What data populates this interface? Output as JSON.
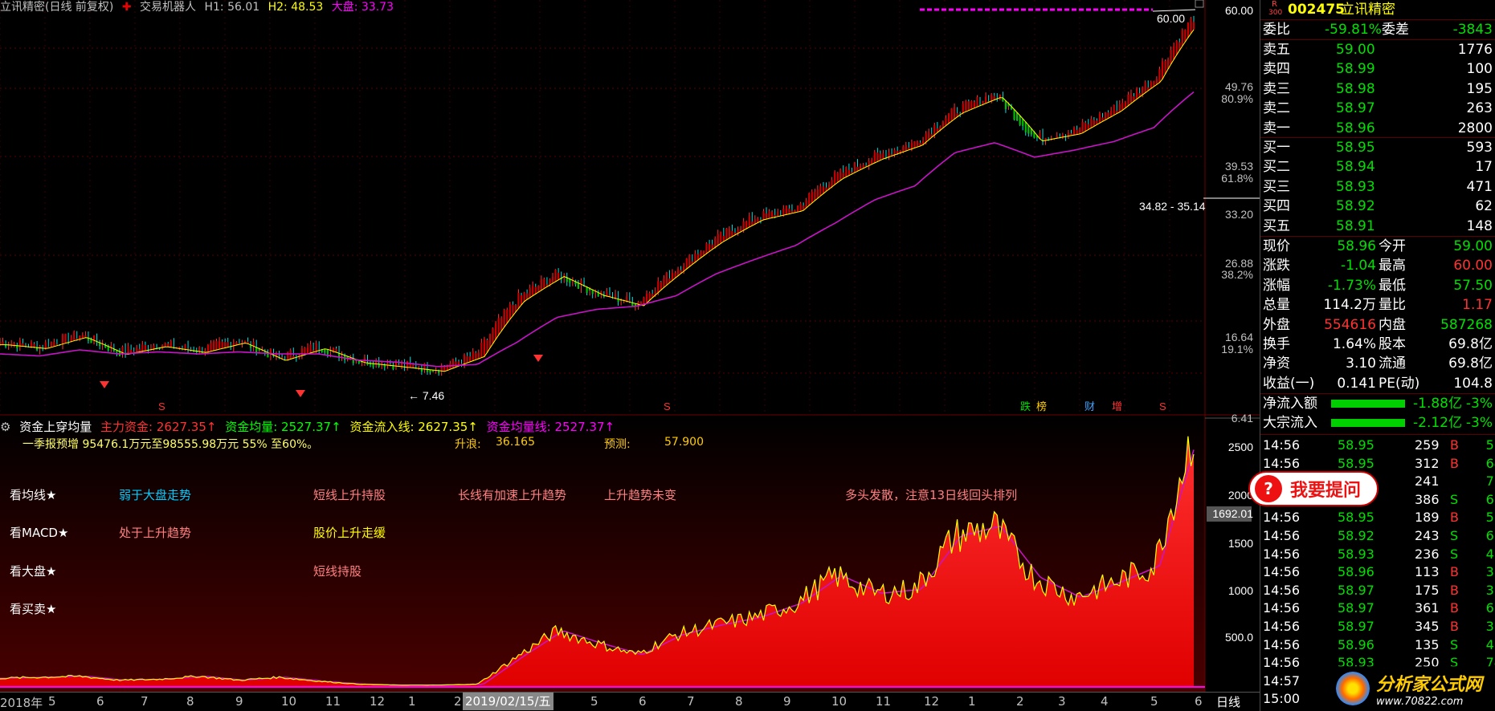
{
  "header": {
    "stock_name_period": "立讯精密(日线 前复权)",
    "robot_label": "交易机器人",
    "h1": "H1: 56.01",
    "h2": "H2: 48.53",
    "market": "大盘: 33.73",
    "colors": {
      "up": "#ff3232",
      "down": "#00e000",
      "ma": "#c814c8",
      "axis_red": "#a00000",
      "yellow": "#ffff00",
      "cyan": "#00ffff"
    }
  },
  "price_axis": {
    "labels": [
      "60.00",
      "49.76",
      "80.9%",
      "39.53",
      "61.8%",
      "33.20",
      "26.88",
      "38.2%",
      "16.64",
      "19.1%",
      "6.41"
    ],
    "annot_high": "60.00",
    "annot_range": "34.82 - 35.14",
    "annot_low": "7.46"
  },
  "signals": {
    "fall": "跌",
    "list": "榜",
    "fin": "财",
    "add": "增",
    "s": "S"
  },
  "indicator": {
    "title": "资金上穿均量",
    "main_fund": "主力资金: 2627.35↑",
    "fund_avg": "资金均量: 2527.37↑",
    "fund_inflow": "资金流入线: 2627.35↑",
    "fund_avg_line": "资金均量线: 2527.37↑",
    "forecast_note": "一季报预增 95476.1万元至98555.98万元 55% 至60%。",
    "wave_label": "升浪:",
    "wave_value": "36.165",
    "predict_label": "预测:",
    "predict_value": "57.900",
    "row_ma": "看均线★",
    "row_macd": "看MACD★",
    "row_market": "看大盘★",
    "row_trade": "看买卖★",
    "c1": "弱于大盘走势",
    "c2": "短线上升持股",
    "c3": "长线有加速上升趋势",
    "c4": "上升趋势未变",
    "c5": "多头发散，注意13日线回头排列",
    "c6": "处于上升趋势",
    "c7": "股价上升走缓",
    "c8": "短线持股",
    "axis": [
      "2500",
      "2000",
      "1692.01",
      "1500",
      "1000",
      "500.0"
    ]
  },
  "chart_data": {
    "type": "line",
    "x": [
      "2018-01",
      "2018-02",
      "2018-03",
      "2018-04",
      "2018-05",
      "2018-06",
      "2018-07",
      "2018-08",
      "2018-09",
      "2018-10",
      "2018-11",
      "2018-12",
      "2019-01",
      "2019-02",
      "2019-03",
      "2019-04",
      "2019-05",
      "2019-06",
      "2019-07",
      "2019-08",
      "2019-09",
      "2019-10",
      "2019-11",
      "2019-12",
      "2020-01",
      "2020-02",
      "2020-03",
      "2020-04",
      "2020-05",
      "2020-06",
      "2020-07"
    ],
    "series": [
      {
        "values": [
          9.2,
          9.0,
          9.6,
          8.7,
          9.1,
          8.8,
          9.3,
          8.4,
          9.0,
          8.3,
          8.1,
          7.9,
          8.6,
          11.8,
          13.6,
          12.2,
          11.5,
          14.0,
          16.6,
          18.8,
          19.8,
          23.8,
          26.6,
          28.8,
          34.6,
          38.0,
          29.5,
          30.8,
          35.0,
          41.5,
          59.0
        ]
      },
      {
        "values": [
          8.6,
          8.5,
          8.8,
          8.6,
          8.7,
          8.6,
          8.7,
          8.6,
          8.6,
          8.3,
          8.2,
          8.0,
          8.1,
          9.2,
          10.6,
          11.1,
          11.3,
          12.0,
          13.6,
          14.8,
          16.0,
          18.2,
          20.8,
          22.5,
          27.2,
          28.8,
          26.5,
          27.6,
          29.0,
          31.4,
          38.5
        ]
      }
    ],
    "indicator_values": [
      80,
      90,
      100,
      60,
      70,
      100,
      60,
      90,
      50,
      20,
      10,
      10,
      20,
      300,
      560,
      430,
      320,
      520,
      620,
      700,
      840,
      1120,
      940,
      980,
      1520,
      1620,
      1100,
      900,
      1050,
      1220,
      2600
    ],
    "ylim": [
      6.41,
      60.0
    ],
    "indicator_ylim": [
      0,
      2600
    ]
  },
  "x_axis": {
    "labels": [
      "2018年",
      "5",
      "6",
      "7",
      "8",
      "9",
      "10",
      "11",
      "12",
      "1",
      "2",
      "3",
      "4",
      "5",
      "6",
      "7",
      "8",
      "9",
      "10",
      "11",
      "12",
      "1",
      "2",
      "3",
      "4",
      "5",
      "6",
      "7"
    ],
    "cursor_date": "2019/02/15/五",
    "period": "日线"
  },
  "quote": {
    "code": "002475",
    "name": "立讯精密",
    "r_tag": "R",
    "r_num": "300",
    "wei_bi": "委比",
    "wei_bi_val": "-59.81%",
    "wei_cha": "委差",
    "wei_cha_val": "-3843",
    "sells": [
      {
        "label": "卖五",
        "price": "59.00",
        "vol": "1776"
      },
      {
        "label": "卖四",
        "price": "58.99",
        "vol": "100"
      },
      {
        "label": "卖三",
        "price": "58.98",
        "vol": "195"
      },
      {
        "label": "卖二",
        "price": "58.97",
        "vol": "263"
      },
      {
        "label": "卖一",
        "price": "58.96",
        "vol": "2800"
      }
    ],
    "buys": [
      {
        "label": "买一",
        "price": "58.95",
        "vol": "593"
      },
      {
        "label": "买二",
        "price": "58.94",
        "vol": "17"
      },
      {
        "label": "买三",
        "price": "58.93",
        "vol": "471"
      },
      {
        "label": "买四",
        "price": "58.92",
        "vol": "62"
      },
      {
        "label": "买五",
        "price": "58.91",
        "vol": "148"
      }
    ],
    "stats": [
      {
        "l": "现价",
        "v": "58.96",
        "l2": "今开",
        "v2": "59.00",
        "c": "g",
        "c2": "g"
      },
      {
        "l": "涨跌",
        "v": "-1.04",
        "l2": "最高",
        "v2": "60.00",
        "c": "g",
        "c2": "r"
      },
      {
        "l": "涨幅",
        "v": "-1.73%",
        "l2": "最低",
        "v2": "57.50",
        "c": "g",
        "c2": "g"
      },
      {
        "l": "总量",
        "v": "114.2万",
        "l2": "量比",
        "v2": "1.17",
        "c": "w",
        "c2": "r"
      },
      {
        "l": "外盘",
        "v": "554616",
        "l2": "内盘",
        "v2": "587268",
        "c": "r",
        "c2": "g"
      },
      {
        "l": "换手",
        "v": "1.64%",
        "l2": "股本",
        "v2": "69.8亿",
        "c": "w",
        "c2": "w"
      },
      {
        "l": "净资",
        "v": "3.10",
        "l2": "流通",
        "v2": "69.8亿",
        "c": "w",
        "c2": "w"
      },
      {
        "l": "收益(一)",
        "v": "0.141",
        "l2": "PE(动)",
        "v2": "104.8",
        "c": "w",
        "c2": "w"
      }
    ],
    "net_inflow": {
      "label": "净流入额",
      "val": "-1.88亿",
      "pct": "-3%"
    },
    "block_inflow": {
      "label": "大宗流入",
      "val": "-2.12亿",
      "pct": "-3%"
    },
    "ticks": [
      {
        "t": "14:56",
        "p": "58.95",
        "v": "259",
        "s": "B",
        "n": "57"
      },
      {
        "t": "14:56",
        "p": "58.95",
        "v": "312",
        "s": "B",
        "n": "64"
      },
      {
        "t": "14:56",
        "p": "",
        "v": "241",
        "s": "",
        "n": "76"
      },
      {
        "t": "14:56",
        "p": "",
        "v": "386",
        "s": "S",
        "n": "62"
      },
      {
        "t": "14:56",
        "p": "58.95",
        "v": "189",
        "s": "B",
        "n": "51"
      },
      {
        "t": "14:56",
        "p": "58.92",
        "v": "243",
        "s": "S",
        "n": "61"
      },
      {
        "t": "14:56",
        "p": "58.93",
        "v": "236",
        "s": "S",
        "n": "43"
      },
      {
        "t": "14:56",
        "p": "58.96",
        "v": "113",
        "s": "B",
        "n": "30"
      },
      {
        "t": "14:56",
        "p": "58.97",
        "v": "175",
        "s": "B",
        "n": "35"
      },
      {
        "t": "14:56",
        "p": "58.97",
        "v": "361",
        "s": "B",
        "n": "68"
      },
      {
        "t": "14:56",
        "p": "58.97",
        "v": "345",
        "s": "B",
        "n": "30"
      },
      {
        "t": "14:56",
        "p": "58.96",
        "v": "135",
        "s": "S",
        "n": "45"
      },
      {
        "t": "14:56",
        "p": "58.93",
        "v": "250",
        "s": "S",
        "n": "74"
      },
      {
        "t": "14:57",
        "p": "",
        "v": "",
        "s": "",
        "n": ""
      },
      {
        "t": "15:00",
        "p": "",
        "v": "",
        "s": "",
        "n": ""
      }
    ]
  },
  "ask_popup": {
    "q": "?",
    "text": "我要提问"
  },
  "watermark": {
    "title": "分析家公式网",
    "url": "www.70822.com"
  }
}
